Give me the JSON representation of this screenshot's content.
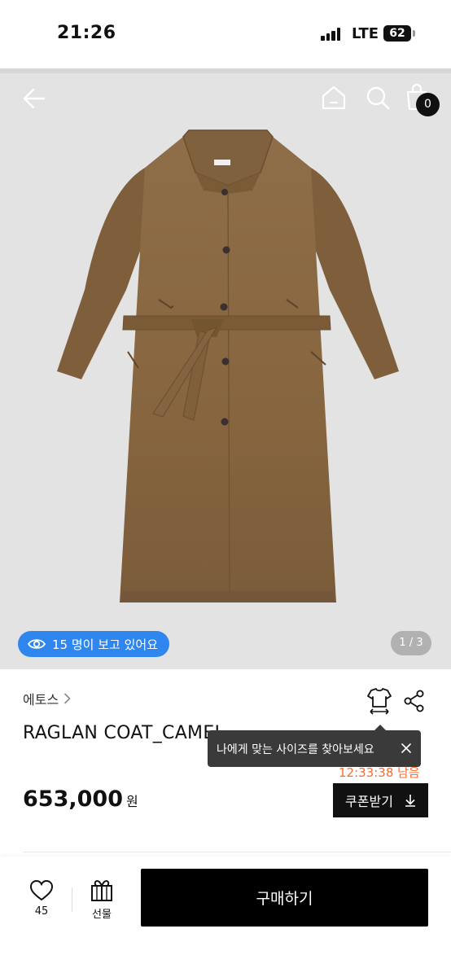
{
  "status_bar": {
    "time": "21:26",
    "network": "LTE",
    "battery": "62"
  },
  "header": {
    "cart_count": "0"
  },
  "gallery": {
    "viewers_text": "15 명이 보고 있어요",
    "page_indicator": "1 / 3"
  },
  "product": {
    "brand": "에토스",
    "name": "RAGLAN COAT_CAMEL",
    "price": "653,000",
    "price_unit": "원",
    "timer_text": "12:33:38 남음",
    "coupon_label": "쿠폰받기"
  },
  "tooltip": {
    "text": "나에게 맞는 사이즈를 찾아보세요"
  },
  "bottom_bar": {
    "like_count": "45",
    "gift_label": "선물",
    "buy_label": "구매하기"
  },
  "colors": {
    "accent_blue": "#2f86ee",
    "timer_orange": "#ff6a2b",
    "coat_camel": "#8a6a44"
  },
  "icons": [
    "back-arrow-icon",
    "home-icon",
    "search-icon",
    "shopping-bag-icon",
    "eye-icon",
    "chevron-right-icon",
    "size-guide-icon",
    "share-icon",
    "close-icon",
    "download-icon",
    "heart-icon",
    "gift-icon"
  ]
}
